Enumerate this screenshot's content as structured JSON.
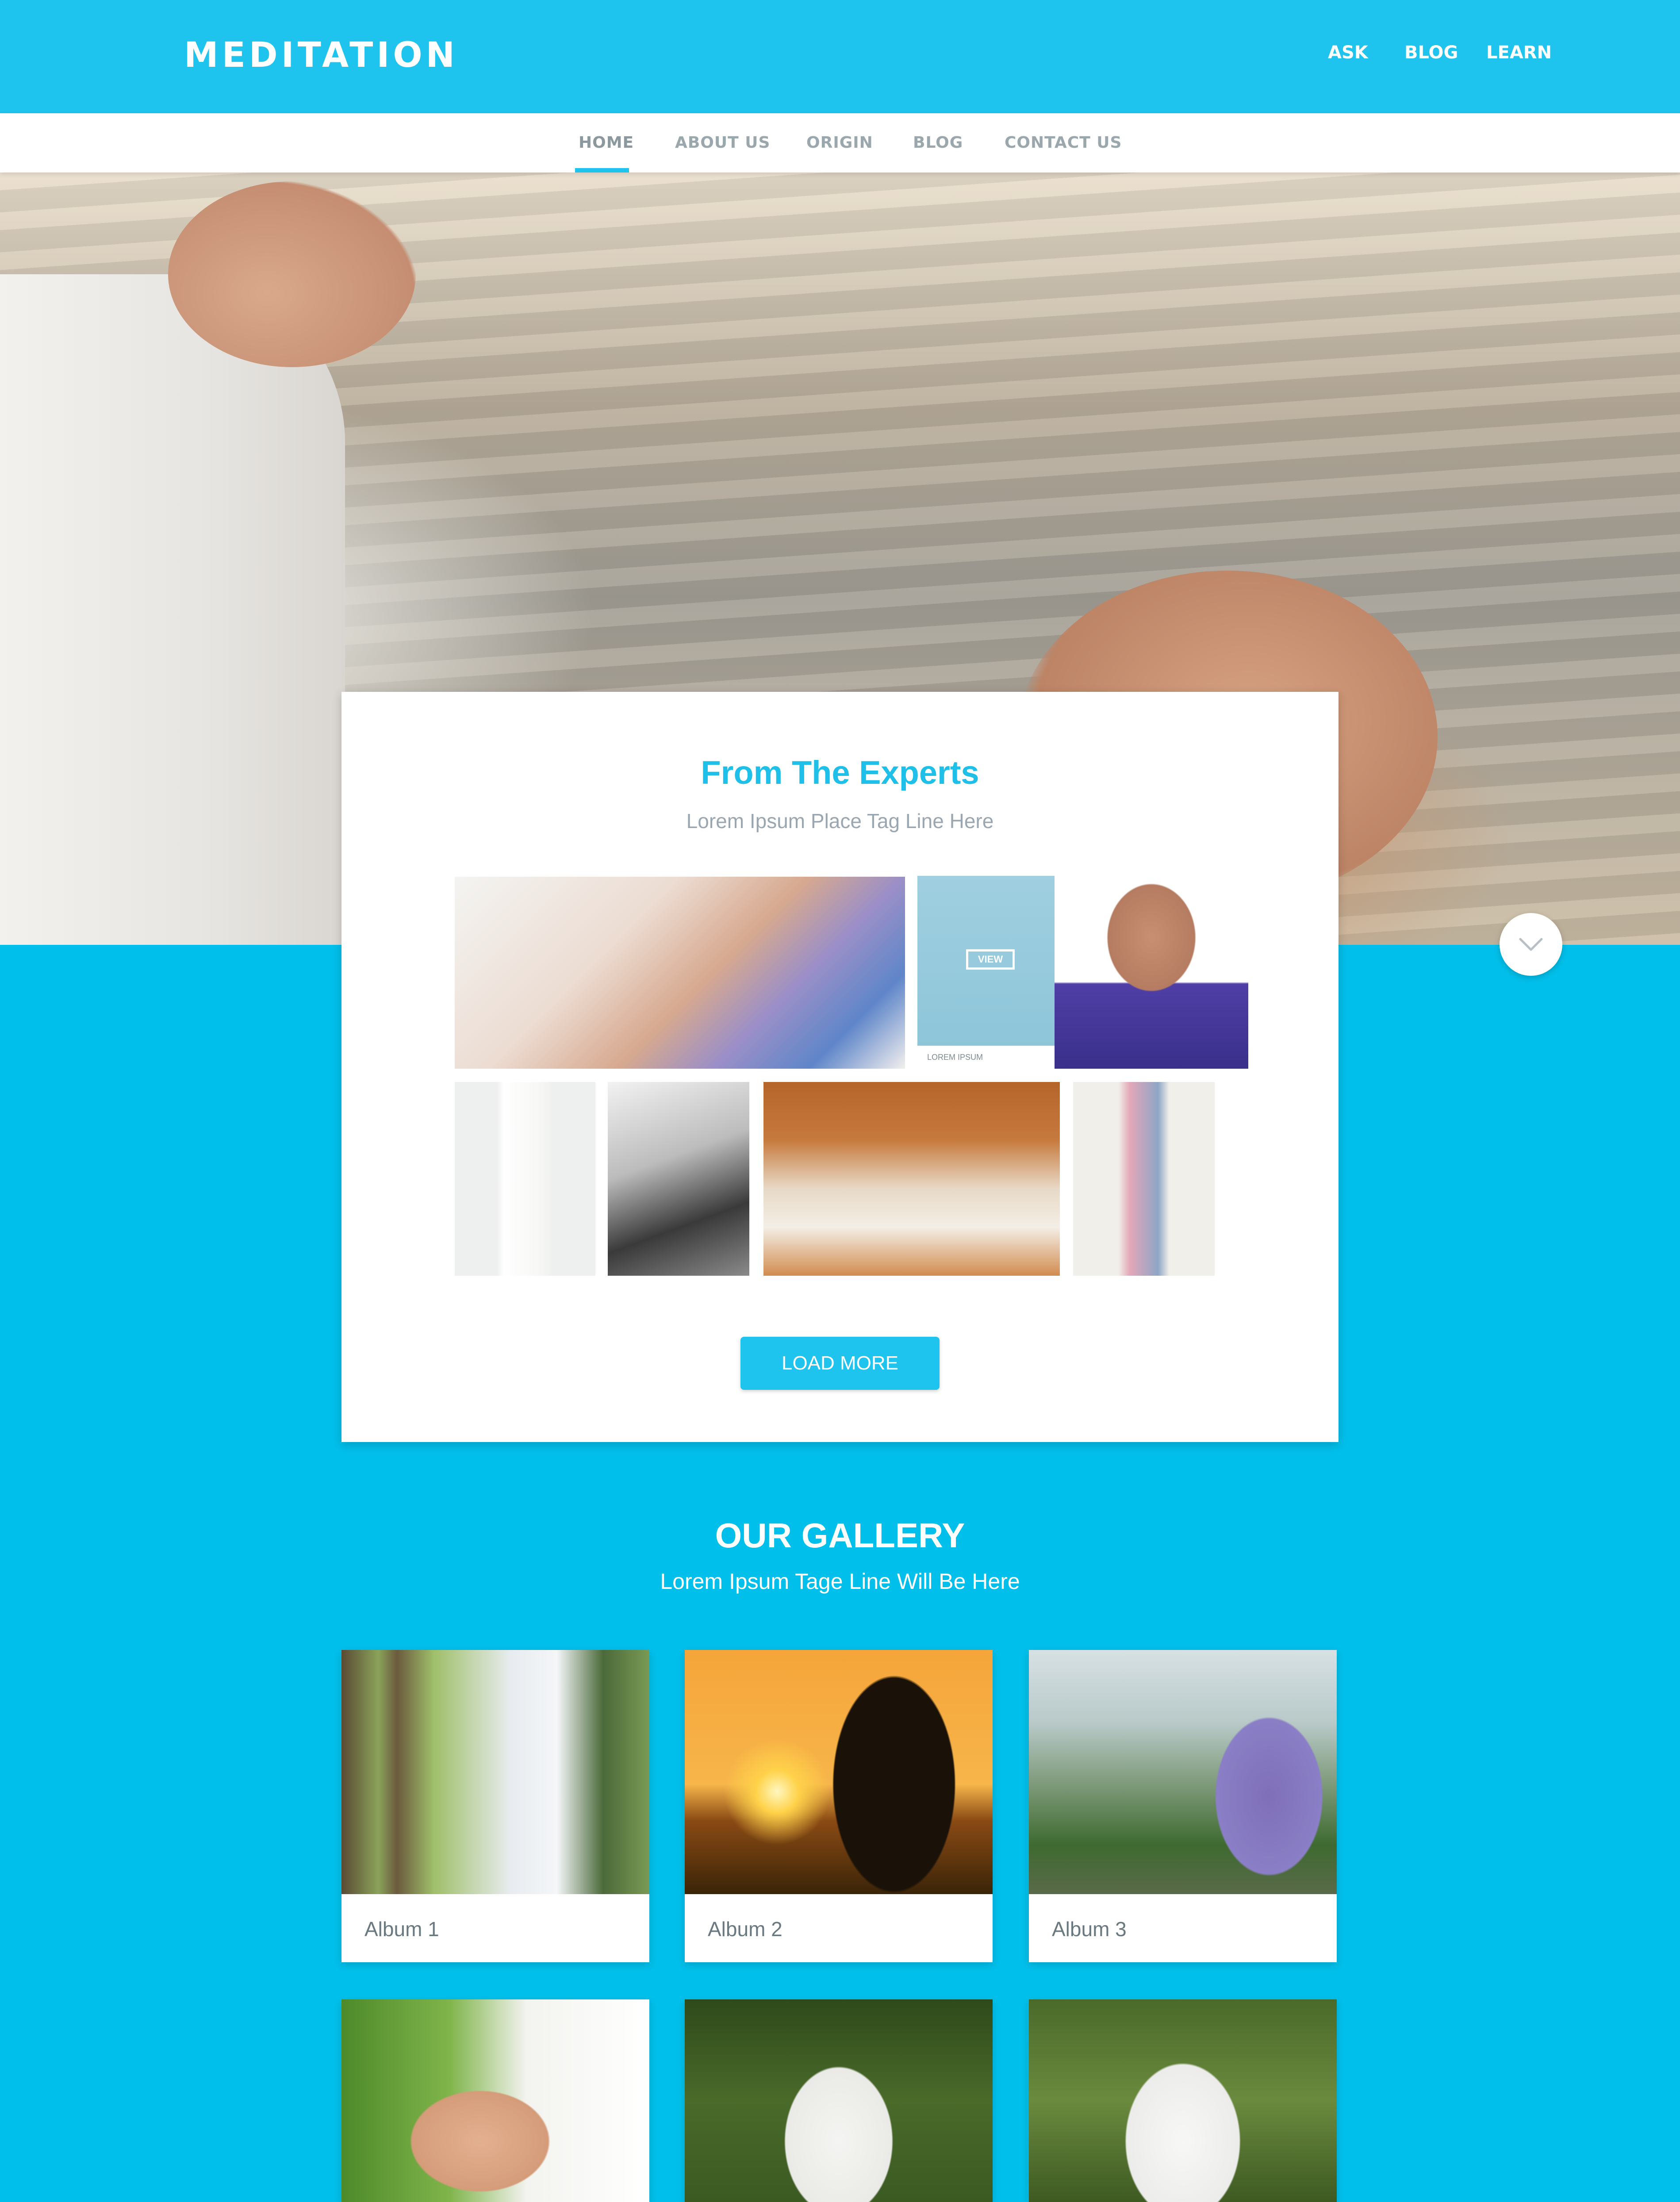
{
  "header": {
    "brand": "MEDITATION",
    "links": [
      "ASK",
      "BLOG",
      "LEARN"
    ],
    "bg_color": "#1ec3ee"
  },
  "subnav": {
    "items": [
      "HOME",
      "ABOUT US",
      "ORIGIN",
      "BLOG",
      "CONTACT US"
    ],
    "active": "HOME"
  },
  "experts": {
    "title": "From The Experts",
    "tagline": "Lorem Ipsum Place Tag Line Here",
    "tile_view_label": "VIEW",
    "tile_caption": "LOREM IPSUM",
    "load_more": "LOAD MORE"
  },
  "gallery": {
    "title": "OUR GALLERY",
    "tagline": "Lorem Ipsum Tage Line Will Be Here",
    "albums": [
      "Album 1",
      "Album 2",
      "Album 3"
    ]
  },
  "icons": {
    "scroll_down": "chevron-down-icon"
  },
  "colors": {
    "accent": "#1ec3ee",
    "page_bg": "#00bfea",
    "title_blue": "#1ebfe9"
  }
}
